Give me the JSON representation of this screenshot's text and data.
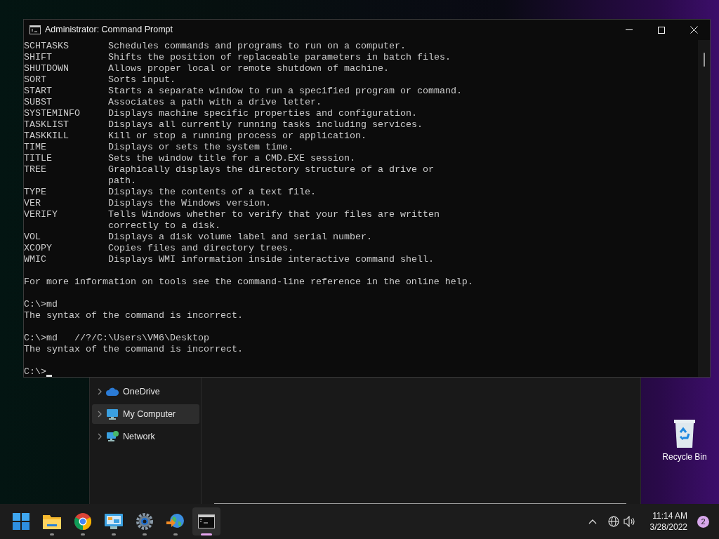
{
  "explorer": {
    "sidebar": [
      {
        "label": "OneDrive",
        "kind": "cloud",
        "selected": false
      },
      {
        "label": "My Computer",
        "kind": "monitor",
        "selected": true
      },
      {
        "label": "Network",
        "kind": "network",
        "selected": false
      }
    ]
  },
  "terminal": {
    "title": "Administrator: Command Prompt",
    "lines": [
      {
        "kind": "entry",
        "name": "SCHTASKS",
        "description": "Schedules commands and programs to run on a computer."
      },
      {
        "kind": "entry",
        "name": "SHIFT",
        "description": "Shifts the position of replaceable parameters in batch files."
      },
      {
        "kind": "entry",
        "name": "SHUTDOWN",
        "description": "Allows proper local or remote shutdown of machine."
      },
      {
        "kind": "entry",
        "name": "SORT",
        "description": "Sorts input."
      },
      {
        "kind": "entry",
        "name": "START",
        "description": "Starts a separate window to run a specified program or command."
      },
      {
        "kind": "entry",
        "name": "SUBST",
        "description": "Associates a path with a drive letter."
      },
      {
        "kind": "entry",
        "name": "SYSTEMINFO",
        "description": "Displays machine specific properties and configuration."
      },
      {
        "kind": "entry",
        "name": "TASKLIST",
        "description": "Displays all currently running tasks including services."
      },
      {
        "kind": "entry",
        "name": "TASKKILL",
        "description": "Kill or stop a running process or application."
      },
      {
        "kind": "entry",
        "name": "TIME",
        "description": "Displays or sets the system time."
      },
      {
        "kind": "entry",
        "name": "TITLE",
        "description": "Sets the window title for a CMD.EXE session."
      },
      {
        "kind": "entry",
        "name": "TREE",
        "description": "Graphically displays the directory structure of a drive or"
      },
      {
        "kind": "continuation",
        "text": "path."
      },
      {
        "kind": "entry",
        "name": "TYPE",
        "description": "Displays the contents of a text file."
      },
      {
        "kind": "entry",
        "name": "VER",
        "description": "Displays the Windows version."
      },
      {
        "kind": "entry",
        "name": "VERIFY",
        "description": "Tells Windows whether to verify that your files are written"
      },
      {
        "kind": "continuation",
        "text": "correctly to a disk."
      },
      {
        "kind": "entry",
        "name": "VOL",
        "description": "Displays a disk volume label and serial number."
      },
      {
        "kind": "entry",
        "name": "XCOPY",
        "description": "Copies files and directory trees."
      },
      {
        "kind": "entry",
        "name": "WMIC",
        "description": "Displays WMI information inside interactive command shell."
      },
      {
        "kind": "blank"
      },
      {
        "kind": "text",
        "text": "For more information on tools see the command-line reference in the online help."
      },
      {
        "kind": "blank"
      },
      {
        "kind": "text",
        "text": "C:\\>md"
      },
      {
        "kind": "text",
        "text": "The syntax of the command is incorrect."
      },
      {
        "kind": "blank"
      },
      {
        "kind": "text",
        "text": "C:\\>md   //?/C:\\Users\\VM6\\Desktop"
      },
      {
        "kind": "text",
        "text": "The syntax of the command is incorrect."
      },
      {
        "kind": "blank"
      },
      {
        "kind": "prompt",
        "text": "C:\\>"
      }
    ]
  },
  "desktop_icons": [
    {
      "label": "Recycle Bin"
    }
  ],
  "taskbar": {
    "apps": [
      {
        "kind": "start",
        "selected": false
      },
      {
        "kind": "folder",
        "selected": false,
        "running": true
      },
      {
        "kind": "chrome",
        "selected": false,
        "running": true
      },
      {
        "kind": "control-panel",
        "selected": false,
        "running": true
      },
      {
        "kind": "settings",
        "selected": false,
        "running": true
      },
      {
        "kind": "globe-arrow",
        "selected": false,
        "running": true
      },
      {
        "kind": "terminal",
        "selected": true,
        "running": true
      }
    ],
    "time": "11:14 AM",
    "date": "3/28/2022",
    "notifications": "2"
  }
}
